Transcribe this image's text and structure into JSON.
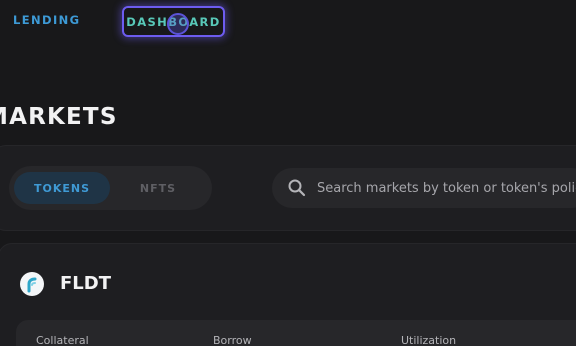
{
  "nav": {
    "lending_label": "LENDING",
    "dashboard_label": "DASHBOARD"
  },
  "page": {
    "title": "MARKETS"
  },
  "filters": {
    "tabs": [
      {
        "label": "TOKENS",
        "selected": true
      },
      {
        "label": "NFTS",
        "selected": false
      }
    ],
    "search": {
      "placeholder": "Search markets by token or token's policy",
      "icon": "search-icon"
    }
  },
  "market": {
    "token_name": "FLDT",
    "logo_icon": "fldt-token-logo",
    "stats": {
      "collateral_label": "Collateral",
      "borrow_label": "Borrow",
      "utilization_label": "Utilization"
    }
  },
  "colors": {
    "background": "#18181a",
    "accent_blue": "#3d9ad6",
    "accent_teal": "#58c8b8",
    "focus_ring": "#6d5cf0"
  }
}
